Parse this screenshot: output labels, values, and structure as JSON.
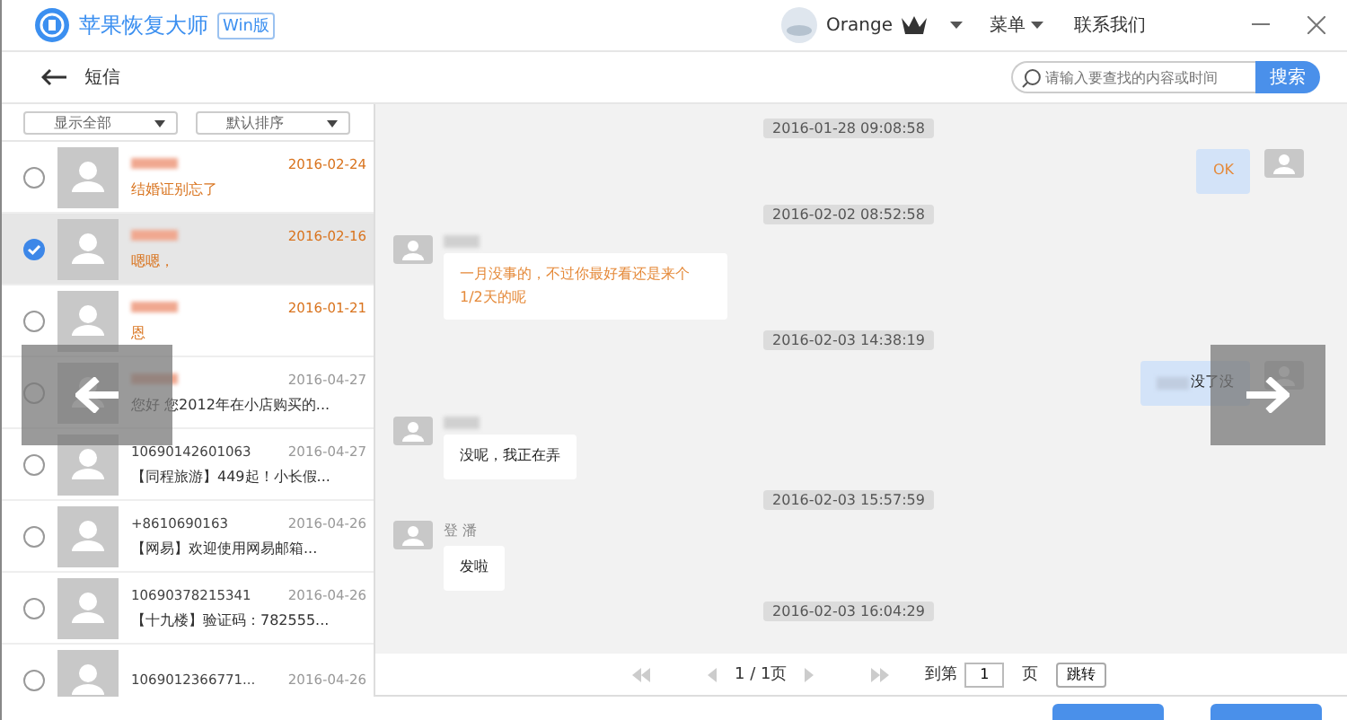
{
  "app": {
    "title": "苹果恢复大师",
    "edition": "Win版",
    "user": "Orange",
    "menu": "菜单",
    "contact": "联系我们"
  },
  "subbar": {
    "title": "短信",
    "search": {
      "placeholder": "请输入要查找的内容或时间"
    },
    "search_button": "搜索"
  },
  "filters": [
    "显示全部",
    "默认排序"
  ],
  "conversations": [
    {
      "name_blurred": true,
      "date": "2016-02-24",
      "preview": "结婚证别忘了",
      "unread": true,
      "selected": false
    },
    {
      "name_blurred": true,
      "date": "2016-02-16",
      "preview": "嗯嗯，",
      "unread": true,
      "selected": true
    },
    {
      "name_blurred": true,
      "date": "2016-01-21",
      "preview": "恩",
      "unread": true,
      "selected": false
    },
    {
      "name_blurred": true,
      "date": "2016-04-27",
      "preview": "您好  您2012年在小店购买的...",
      "unread": false,
      "selected": false
    },
    {
      "name": "10690142601063",
      "name_blurred": false,
      "date": "2016-04-27",
      "preview": "【同程旅游】449起！小长假...",
      "unread": false,
      "selected": false
    },
    {
      "name": "+8610690163",
      "name_blurred": false,
      "date": "2016-04-26",
      "preview": "【网易】欢迎使用网易邮箱...",
      "unread": false,
      "selected": false
    },
    {
      "name": "10690378215341",
      "name_blurred": false,
      "date": "2016-04-26",
      "preview": "【十九楼】验证码：782555...",
      "unread": false,
      "selected": false
    },
    {
      "name": "1069012366771...",
      "name_blurred": false,
      "date": "2016-04-26",
      "unread": false,
      "selected": false
    }
  ],
  "messages": [
    {
      "kind": "time",
      "text": "2016-01-28 09:08:58"
    },
    {
      "kind": "outgoing",
      "text": "OK",
      "highlighted": true,
      "blurred_prefix": false
    },
    {
      "kind": "time",
      "text": "2016-02-02 08:52:58"
    },
    {
      "kind": "incoming",
      "sender_blurred": true,
      "text": "一月没事的，不过你最好看还是来个1/2天的呢",
      "highlighted": true
    },
    {
      "kind": "time",
      "text": "2016-02-03 14:38:19"
    },
    {
      "kind": "outgoing",
      "text": "没了没",
      "highlighted": false,
      "blurred_prefix": true
    },
    {
      "kind": "incoming",
      "sender_blurred": true,
      "text": "没呢，我正在弄",
      "highlighted": false
    },
    {
      "kind": "time",
      "text": "2016-02-03 15:57:59"
    },
    {
      "kind": "incoming",
      "sender": "登 潘",
      "sender_blurred": false,
      "text": "发啦",
      "highlighted": false
    },
    {
      "kind": "time",
      "text": "2016-02-03 16:04:29"
    }
  ],
  "pagination": {
    "page": "1 / 1页",
    "goto_label": "到第",
    "goto_value": "1",
    "page_unit": "页",
    "jump_button": "跳转"
  }
}
